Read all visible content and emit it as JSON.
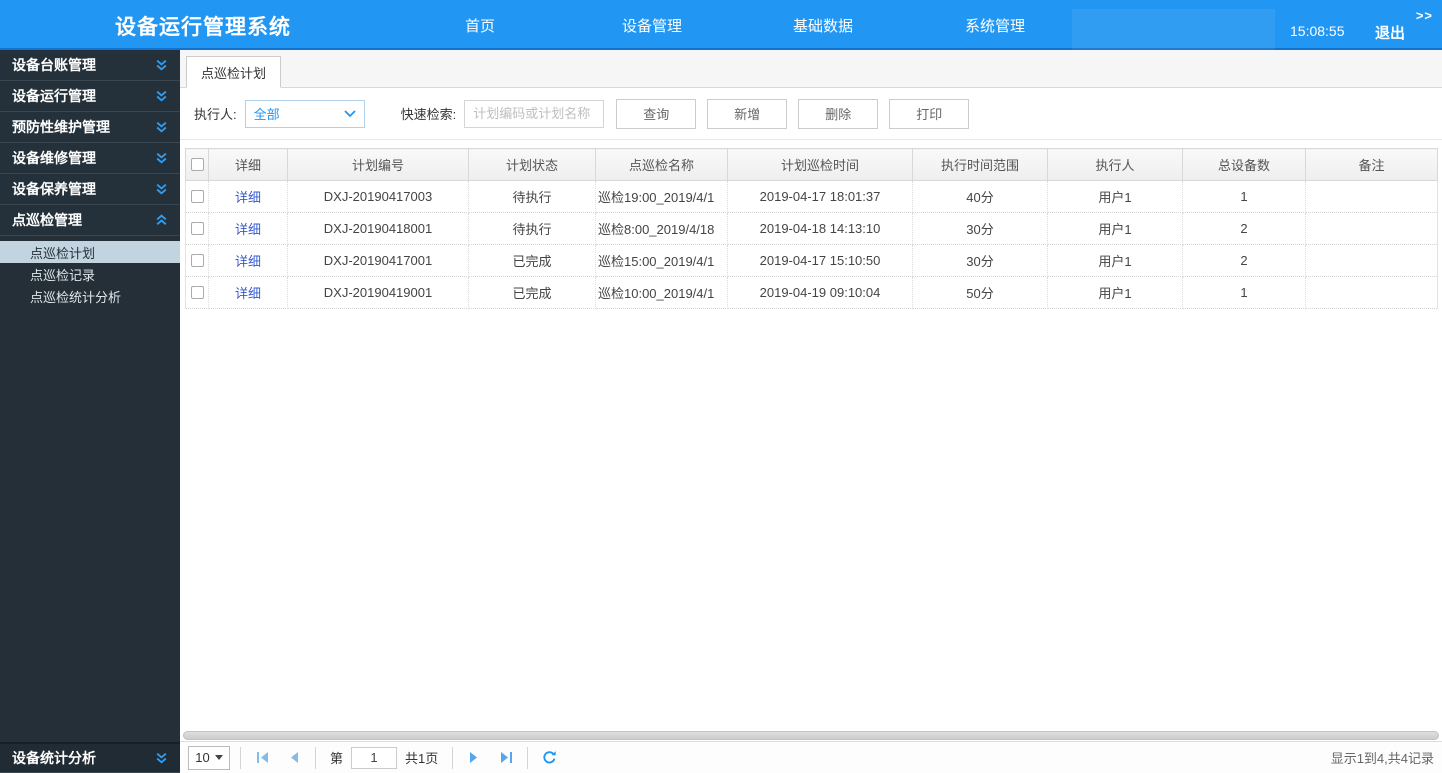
{
  "navbar": {
    "title": "设备运行管理系统",
    "items": [
      {
        "label": "首页"
      },
      {
        "label": "设备管理"
      },
      {
        "label": "基础数据"
      },
      {
        "label": "系统管理"
      }
    ],
    "time": "15:08:55",
    "logout_label": "退出",
    "expand_label": ">>"
  },
  "sidebar": {
    "items": [
      {
        "label": "设备台账管理"
      },
      {
        "label": "设备运行管理"
      },
      {
        "label": "预防性维护管理"
      },
      {
        "label": "设备维修管理"
      },
      {
        "label": "设备保养管理"
      },
      {
        "label": "点巡检管理"
      },
      {
        "label": "设备统计分析"
      }
    ],
    "submenu": [
      {
        "label": "点巡检计划",
        "active": true
      },
      {
        "label": "点巡检记录",
        "active": false
      },
      {
        "label": "点巡检统计分析",
        "active": false
      }
    ]
  },
  "tabs": [
    {
      "label": "点巡检计划",
      "active": true
    }
  ],
  "filter": {
    "executor_label": "执行人:",
    "executor_value": "全部",
    "search_label": "快速检索:",
    "search_placeholder": "计划编码或计划名称",
    "buttons": [
      {
        "label": "查询"
      },
      {
        "label": "新增"
      },
      {
        "label": "删除"
      },
      {
        "label": "打印"
      }
    ]
  },
  "table": {
    "columns": [
      "详细",
      "计划编号",
      "计划状态",
      "点巡检名称",
      "计划巡检时间",
      "执行时间范围",
      "执行人",
      "总设备数",
      "备注"
    ],
    "rows": [
      {
        "detail": "详细",
        "plan_no": "DXJ-20190417003",
        "status": "待执行",
        "name": "巡检19:00_2019/4/1",
        "time": "2019-04-17 18:01:37",
        "range": "40分",
        "executor": "用户1",
        "device_count": "1",
        "remark": ""
      },
      {
        "detail": "详细",
        "plan_no": "DXJ-20190418001",
        "status": "待执行",
        "name": "巡检8:00_2019/4/18",
        "time": "2019-04-18 14:13:10",
        "range": "30分",
        "executor": "用户1",
        "device_count": "2",
        "remark": ""
      },
      {
        "detail": "详细",
        "plan_no": "DXJ-20190417001",
        "status": "已完成",
        "name": "巡检15:00_2019/4/1",
        "time": "2019-04-17 15:10:50",
        "range": "30分",
        "executor": "用户1",
        "device_count": "2",
        "remark": ""
      },
      {
        "detail": "详细",
        "plan_no": "DXJ-20190419001",
        "status": "已完成",
        "name": "巡检10:00_2019/4/1",
        "time": "2019-04-19 09:10:04",
        "range": "50分",
        "executor": "用户1",
        "device_count": "1",
        "remark": ""
      }
    ]
  },
  "pagination": {
    "page_size": "10",
    "page_prefix": "第",
    "current_page": "1",
    "total_pages_label": "共1页",
    "summary": "显示1到4,共4记录"
  },
  "colors": {
    "accent_blue": "#2196f3",
    "navbar_bg": "#2196f3",
    "sidebar_bg": "#25313a",
    "active_submenu_bg": "#c3d4e1",
    "link_blue": "#365bd2"
  }
}
